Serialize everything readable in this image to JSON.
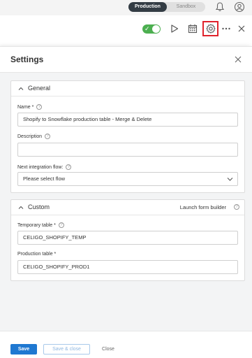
{
  "environment": {
    "production_label": "Production",
    "sandbox_label": "Sandbox",
    "active": "Production"
  },
  "icons": {
    "bell": "bell-icon",
    "account": "account-icon",
    "flow_toggle": "toggle-switch-icon",
    "run": "play-icon",
    "schedule": "calendar-icon",
    "settings": "gear-icon",
    "more": "more-icon",
    "close": "close-icon"
  },
  "flow_toolbar": {
    "flow_enabled": true
  },
  "panel": {
    "title": "Settings"
  },
  "general": {
    "title": "General",
    "name_label": "Name *",
    "name_value": "Shopify to Snowflake production table - Merge & Delete",
    "description_label": "Description",
    "description_value": "",
    "next_flow_label": "Next integration flow:",
    "next_flow_placeholder": "Please select flow"
  },
  "custom": {
    "title": "Custom",
    "launch_label": "Launch form builder",
    "temp_table_label": "Temporary table *",
    "temp_table_value": "CELIGO_SHOPIFY_TEMP",
    "prod_table_label": "Production table *",
    "prod_table_value": "CELIGO_SHOPIFY_PROD1"
  },
  "footer": {
    "save_label": "Save",
    "save_close_label": "Save & close",
    "close_label": "Close"
  },
  "colors": {
    "primary": "#1f78d1",
    "toggle_on": "#4caf50",
    "highlight": "#e0232c",
    "env_active": "#333c44"
  }
}
